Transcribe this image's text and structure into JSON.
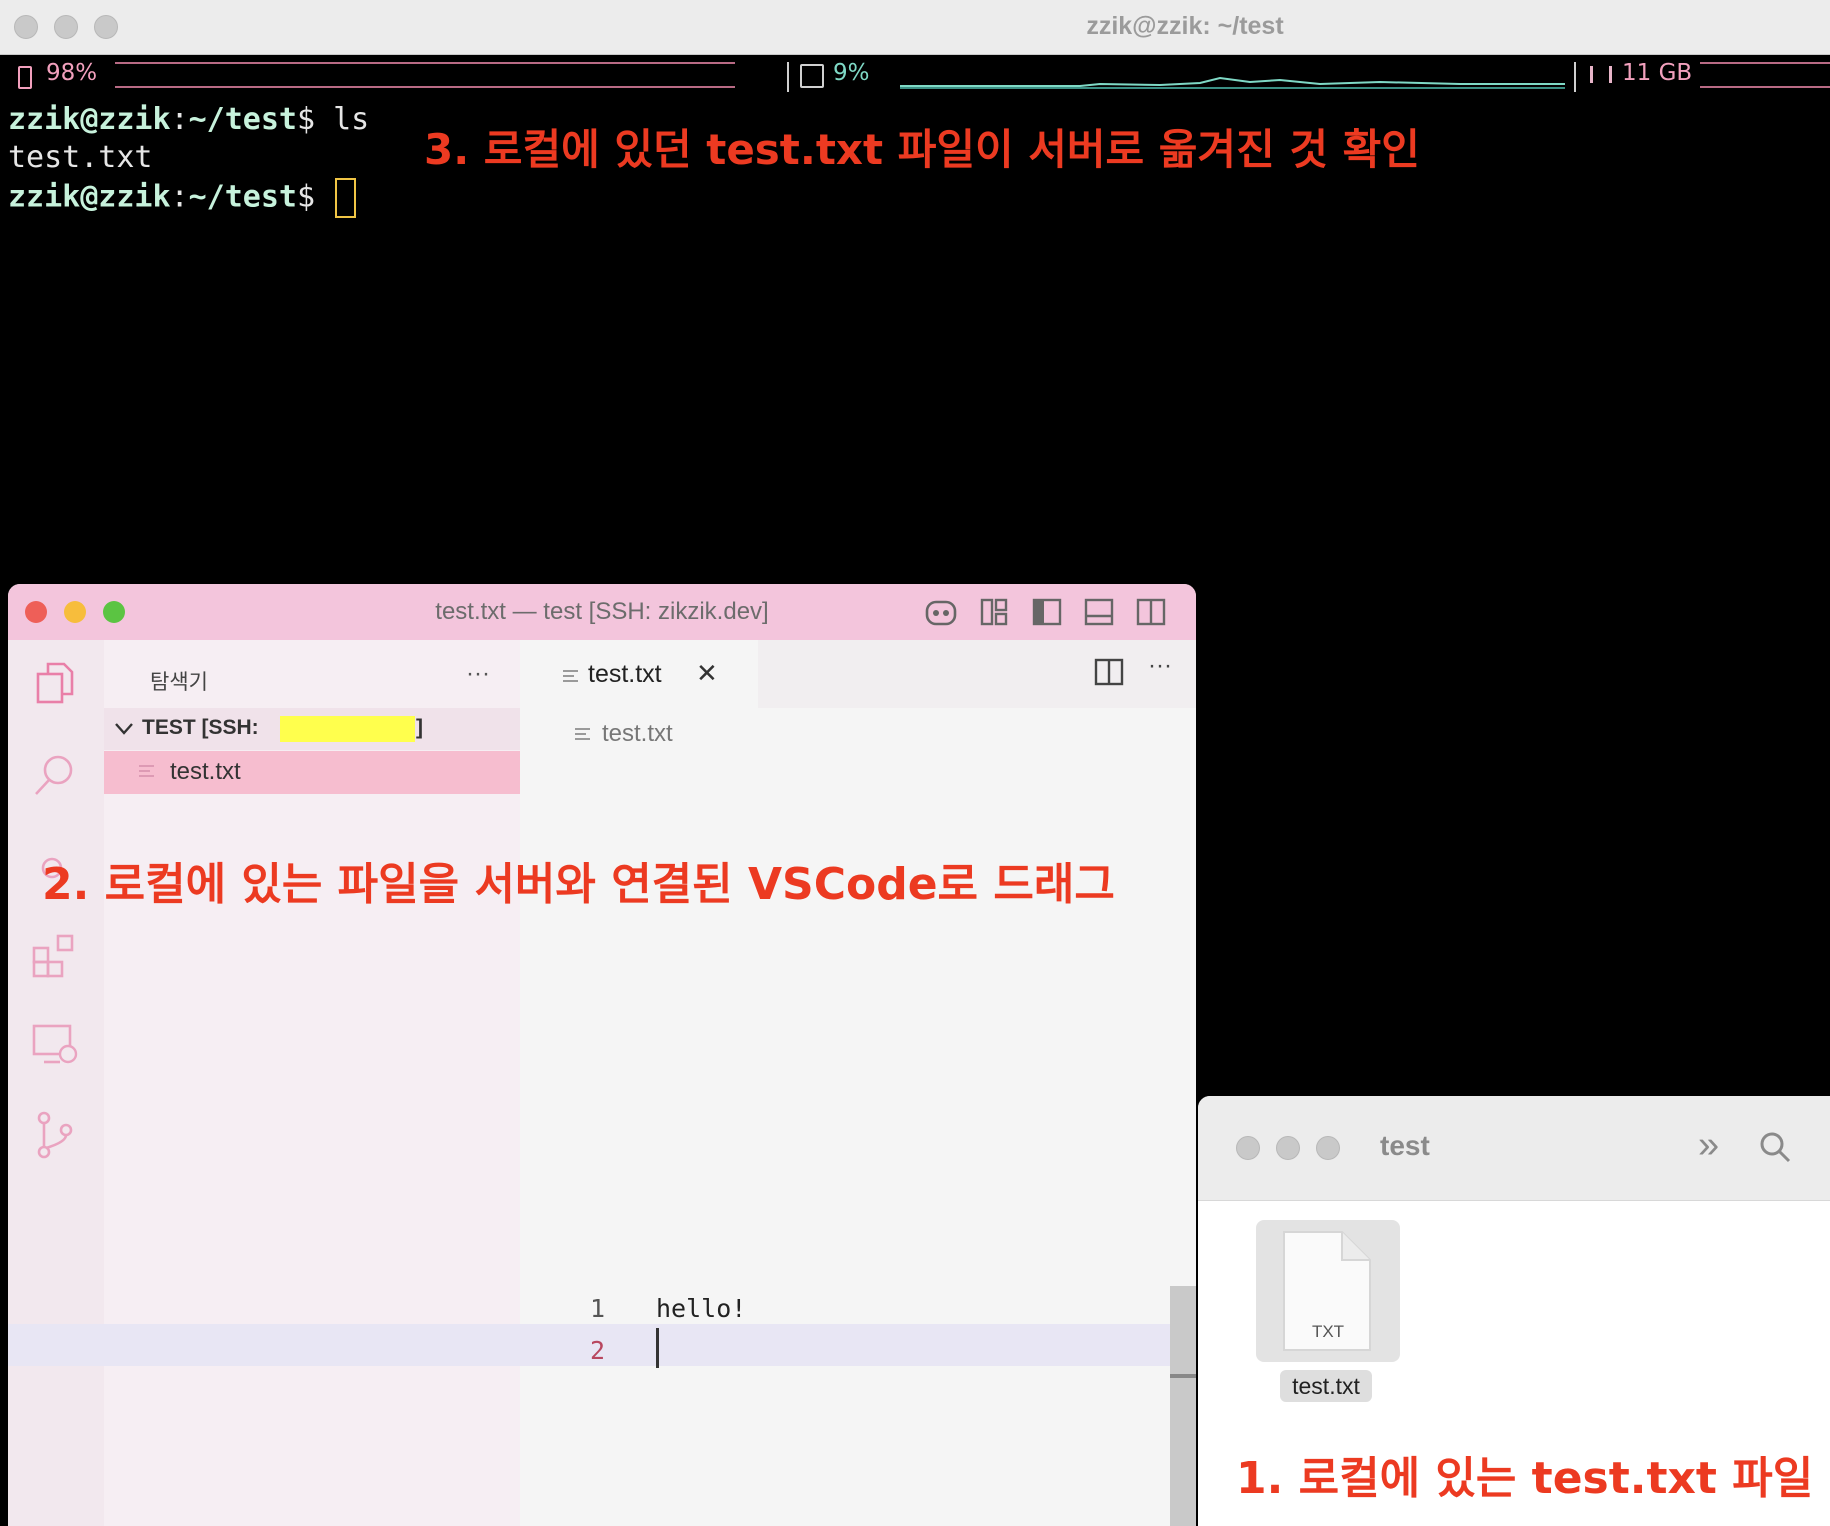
{
  "terminal": {
    "title": "zzik@zzik: ~/test",
    "status": {
      "battery": "98%",
      "cpu": "9%",
      "memory": "11 GB"
    },
    "lines": [
      {
        "user": "zzik@zzik",
        "sep": ":",
        "path": "~/test",
        "dollar": "$",
        "cmd": " ls"
      },
      {
        "output": "test.txt"
      },
      {
        "user": "zzik@zzik",
        "sep": ":",
        "path": "~/test",
        "dollar": "$",
        "cmd": " "
      }
    ]
  },
  "annotations": {
    "step3": "3. 로컬에 있던 test.txt 파일이 서버로 옮겨진 것 확인",
    "step2": "2. 로컬에 있는 파일을 서버와 연결된 VSCode로 드래그",
    "step1": "1. 로컬에 있는 test.txt 파일"
  },
  "vscode": {
    "title": "test.txt — test [SSH: zikzik.dev]",
    "sidebar_title": "탐색기",
    "more": "···",
    "folder_label": "TEST [SSH:",
    "folder_label_end": "]",
    "file": "test.txt",
    "tab": {
      "label": "test.txt",
      "close": "✕"
    },
    "breadcrumb": "test.txt",
    "editor_lines": [
      {
        "num": "1",
        "text": "hello!"
      },
      {
        "num": "2",
        "text": ""
      }
    ]
  },
  "finder": {
    "title": "test",
    "chevrons": "»",
    "file_type": "TXT",
    "file_name": "test.txt"
  },
  "colors": {
    "annotation": "#ec3a21",
    "vscode_titlebar": "#f3c5dc",
    "selected_file": "#f6bdcf",
    "redaction": "#ffff4d"
  }
}
